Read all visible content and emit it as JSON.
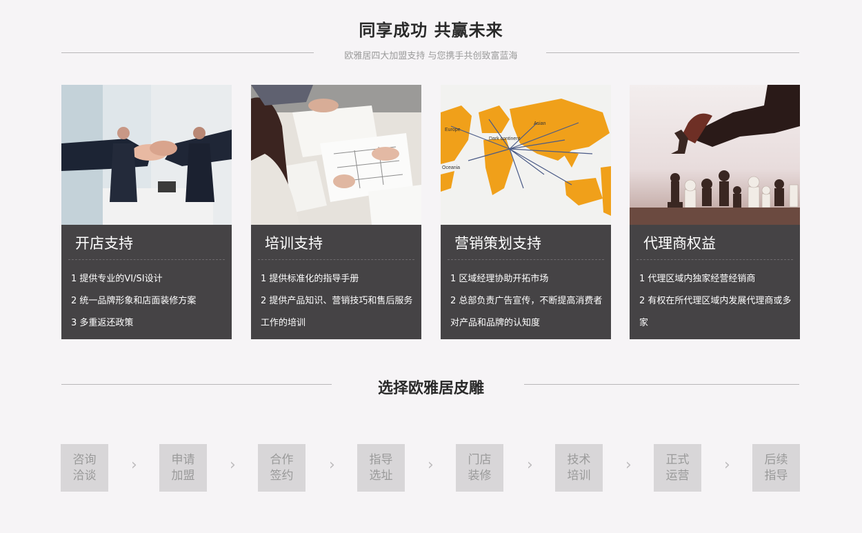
{
  "header": {
    "title": "同享成功 共赢未来",
    "subtitle": "欧雅居四大加盟支持 与您携手共创致富蓝海"
  },
  "cards": [
    {
      "title": "开店支持",
      "lines": [
        "1 提供专业的VI/SI设计",
        "2 统一品牌形象和店面装修方案",
        "3 多重返还政策"
      ],
      "photo": "handshake-photo"
    },
    {
      "title": "培训支持",
      "lines": [
        "1 提供标准化的指导手册",
        "2 提供产品知识、营销技巧和售后服务工作的培训"
      ],
      "photo": "training-photo"
    },
    {
      "title": "营销策划支持",
      "lines": [
        "1 区域经理协助开拓市场",
        "2 总部负责广告宣传，不断提高消费者对产品和品牌的认知度"
      ],
      "photo": "world-map-photo",
      "map_labels": [
        "Europe",
        "Asian",
        "Dark continent",
        "Oceania"
      ]
    },
    {
      "title": "代理商权益",
      "lines": [
        "1 代理区域内独家经营经销商",
        "2 有权在所代理区域内发展代理商或多家"
      ],
      "photo": "chess-photo"
    }
  ],
  "section2": {
    "title": "选择欧雅居皮雕"
  },
  "steps": [
    {
      "line1": "咨询",
      "line2": "洽谈"
    },
    {
      "line1": "申请",
      "line2": "加盟"
    },
    {
      "line1": "合作",
      "line2": "签约"
    },
    {
      "line1": "指导",
      "line2": "选址"
    },
    {
      "line1": "门店",
      "line2": "装修"
    },
    {
      "line1": "技术",
      "line2": "培训"
    },
    {
      "line1": "正式",
      "line2": "运营"
    },
    {
      "line1": "后续",
      "line2": "指导"
    }
  ],
  "arrow_glyph": "›",
  "colors": {
    "background": "#f6f4f6",
    "card": "#454345",
    "step_box": "#d8d6d8",
    "step_text": "#9a9a9a",
    "map_orange": "#f0a01a"
  }
}
